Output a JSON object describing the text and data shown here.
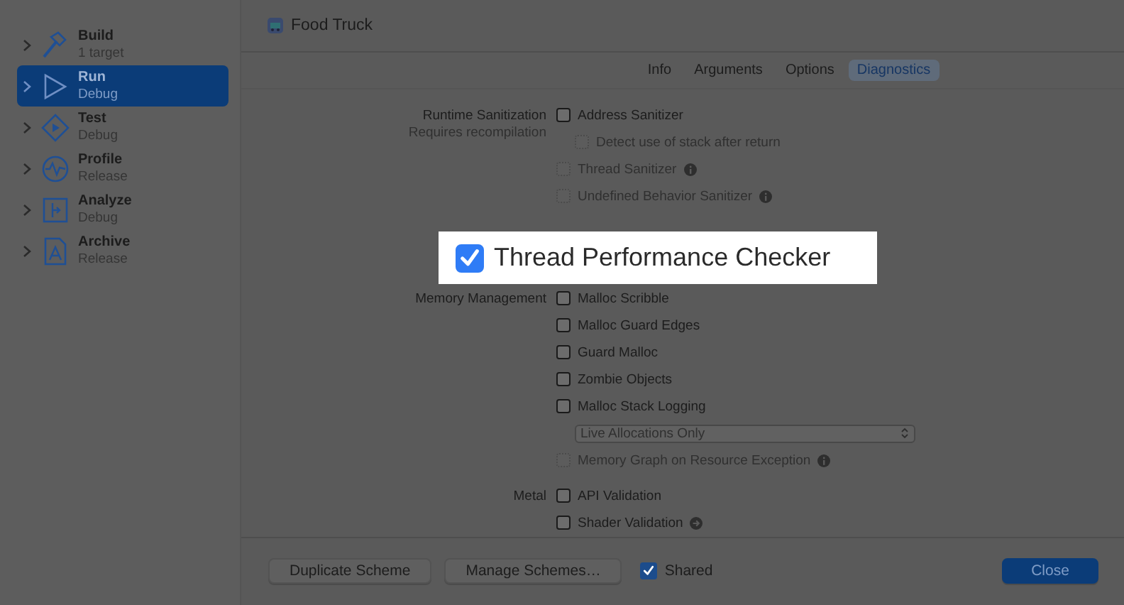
{
  "sidebar": {
    "items": [
      {
        "kind": "build",
        "title": "Build",
        "subtitle": "1 target",
        "selected": false
      },
      {
        "kind": "run",
        "title": "Run",
        "subtitle": "Debug",
        "selected": true
      },
      {
        "kind": "test",
        "title": "Test",
        "subtitle": "Debug",
        "selected": false
      },
      {
        "kind": "profile",
        "title": "Profile",
        "subtitle": "Release",
        "selected": false
      },
      {
        "kind": "analyze",
        "title": "Analyze",
        "subtitle": "Debug",
        "selected": false
      },
      {
        "kind": "archive",
        "title": "Archive",
        "subtitle": "Release",
        "selected": false
      }
    ]
  },
  "header": {
    "title": "Food Truck"
  },
  "tabs": [
    {
      "label": "Info",
      "selected": false
    },
    {
      "label": "Arguments",
      "selected": false
    },
    {
      "label": "Options",
      "selected": false
    },
    {
      "label": "Diagnostics",
      "selected": true
    }
  ],
  "sections": [
    {
      "label": "Runtime Sanitization",
      "note": "Requires recompilation",
      "options": [
        {
          "kind": "checkbox",
          "label": "Address Sanitizer",
          "checked": false,
          "disabled": false,
          "children": [
            {
              "kind": "checkbox",
              "label": "Detect use of stack after return",
              "checked": false,
              "disabled": true
            }
          ]
        },
        {
          "kind": "checkbox",
          "label": "Thread Sanitizer",
          "checked": false,
          "disabled": true,
          "info": true
        },
        {
          "kind": "checkbox",
          "label": "Undefined Behavior Sanitizer",
          "checked": false,
          "disabled": true,
          "info": true
        }
      ]
    },
    {
      "label": "Memory Management",
      "options": [
        {
          "kind": "checkbox",
          "label": "Malloc Scribble",
          "checked": false,
          "disabled": false
        },
        {
          "kind": "checkbox",
          "label": "Malloc Guard Edges",
          "checked": false,
          "disabled": false
        },
        {
          "kind": "checkbox",
          "label": "Guard Malloc",
          "checked": false,
          "disabled": false
        },
        {
          "kind": "checkbox",
          "label": "Zombie Objects",
          "checked": false,
          "disabled": false
        },
        {
          "kind": "checkbox",
          "label": "Malloc Stack Logging",
          "checked": false,
          "disabled": false,
          "children": [
            {
              "kind": "popup",
              "value": "Live Allocations Only",
              "disabled": true
            }
          ]
        },
        {
          "kind": "checkbox",
          "label": "Memory Graph on Resource Exception",
          "checked": false,
          "disabled": true,
          "info": true
        }
      ]
    },
    {
      "label": "Metal",
      "options": [
        {
          "kind": "checkbox",
          "label": "API Validation",
          "checked": false,
          "disabled": false
        },
        {
          "kind": "checkbox",
          "label": "Shader Validation",
          "checked": false,
          "disabled": false,
          "arrow": true
        }
      ]
    }
  ],
  "callout": {
    "label": "Thread Performance Checker",
    "checked": true
  },
  "footer": {
    "buttons": [
      "Duplicate Scheme",
      "Manage Schemes…"
    ],
    "shared": {
      "label": "Shared",
      "checked": true
    },
    "close": {
      "label": "Close"
    }
  }
}
